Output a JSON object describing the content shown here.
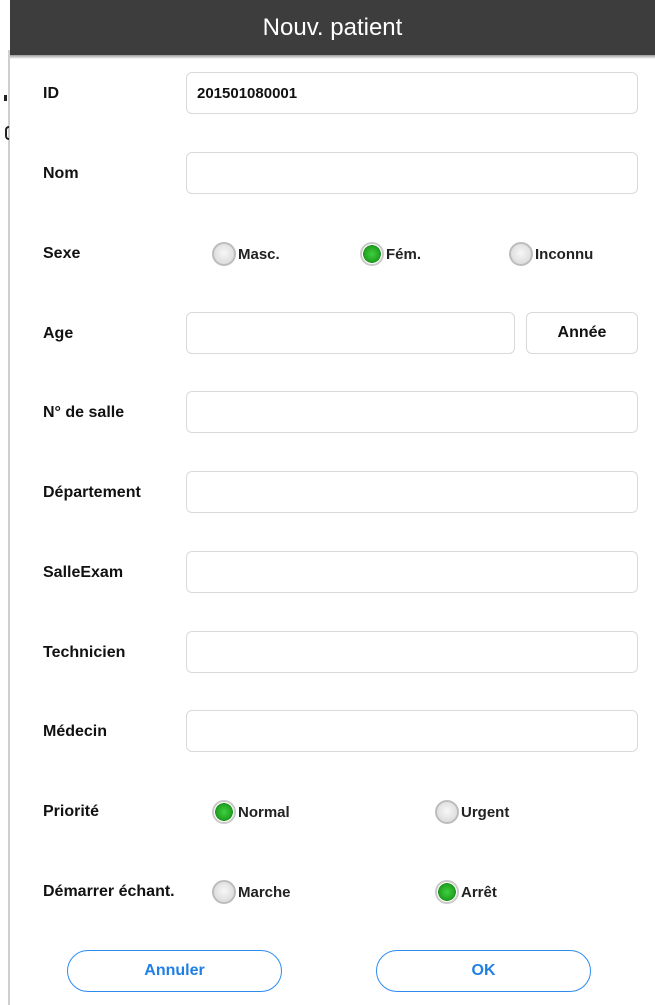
{
  "header": {
    "title": "Nouv. patient"
  },
  "fields": {
    "id": {
      "label": "ID",
      "value": "201501080001"
    },
    "name": {
      "label": "Nom",
      "value": ""
    },
    "sex": {
      "label": "Sexe",
      "options": [
        "Masc.",
        "Fém.",
        "Inconnu"
      ],
      "selected": "Fém."
    },
    "age": {
      "label": "Age",
      "value": "",
      "unit_button": "Année"
    },
    "room": {
      "label": "N° de salle",
      "value": ""
    },
    "department": {
      "label": "Département",
      "value": ""
    },
    "exam_room": {
      "label": "SalleExam",
      "value": ""
    },
    "technician": {
      "label": "Technicien",
      "value": ""
    },
    "doctor": {
      "label": "Médecin",
      "value": ""
    },
    "priority": {
      "label": "Priorité",
      "options": [
        "Normal",
        "Urgent"
      ],
      "selected": "Normal"
    },
    "start_sampling": {
      "label": "Démarrer échant.",
      "options": [
        "Marche",
        "Arrêt"
      ],
      "selected": "Arrêt"
    }
  },
  "buttons": {
    "cancel": "Annuler",
    "ok": "OK"
  },
  "colors": {
    "title_bar": "#3d3d3d",
    "radio_selected": "#21a321",
    "button_accent": "#2d8cf0"
  }
}
